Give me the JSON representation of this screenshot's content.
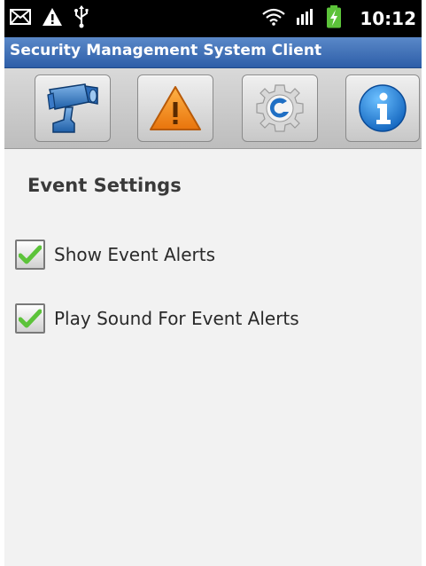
{
  "status_bar": {
    "icons_left": [
      "email-icon",
      "warning-icon",
      "usb-icon"
    ],
    "icons_right": [
      "wifi-icon",
      "signal-icon",
      "battery-charging-icon"
    ],
    "time": "10:12"
  },
  "app": {
    "title": "Security Management System Client"
  },
  "toolbar": {
    "buttons": [
      {
        "icon": "camera-icon"
      },
      {
        "icon": "alert-triangle-icon"
      },
      {
        "icon": "settings-gear-icon"
      },
      {
        "icon": "info-icon"
      }
    ]
  },
  "settings": {
    "section_title": "Event Settings",
    "options": [
      {
        "label": "Show Event Alerts",
        "checked": true
      },
      {
        "label": "Play Sound For Event Alerts",
        "checked": true
      }
    ]
  },
  "colors": {
    "title_bar": "#2d5ea8",
    "checkmark": "#5cc33a",
    "alert_orange": "#f08a1c",
    "info_blue": "#1a7fd8"
  }
}
